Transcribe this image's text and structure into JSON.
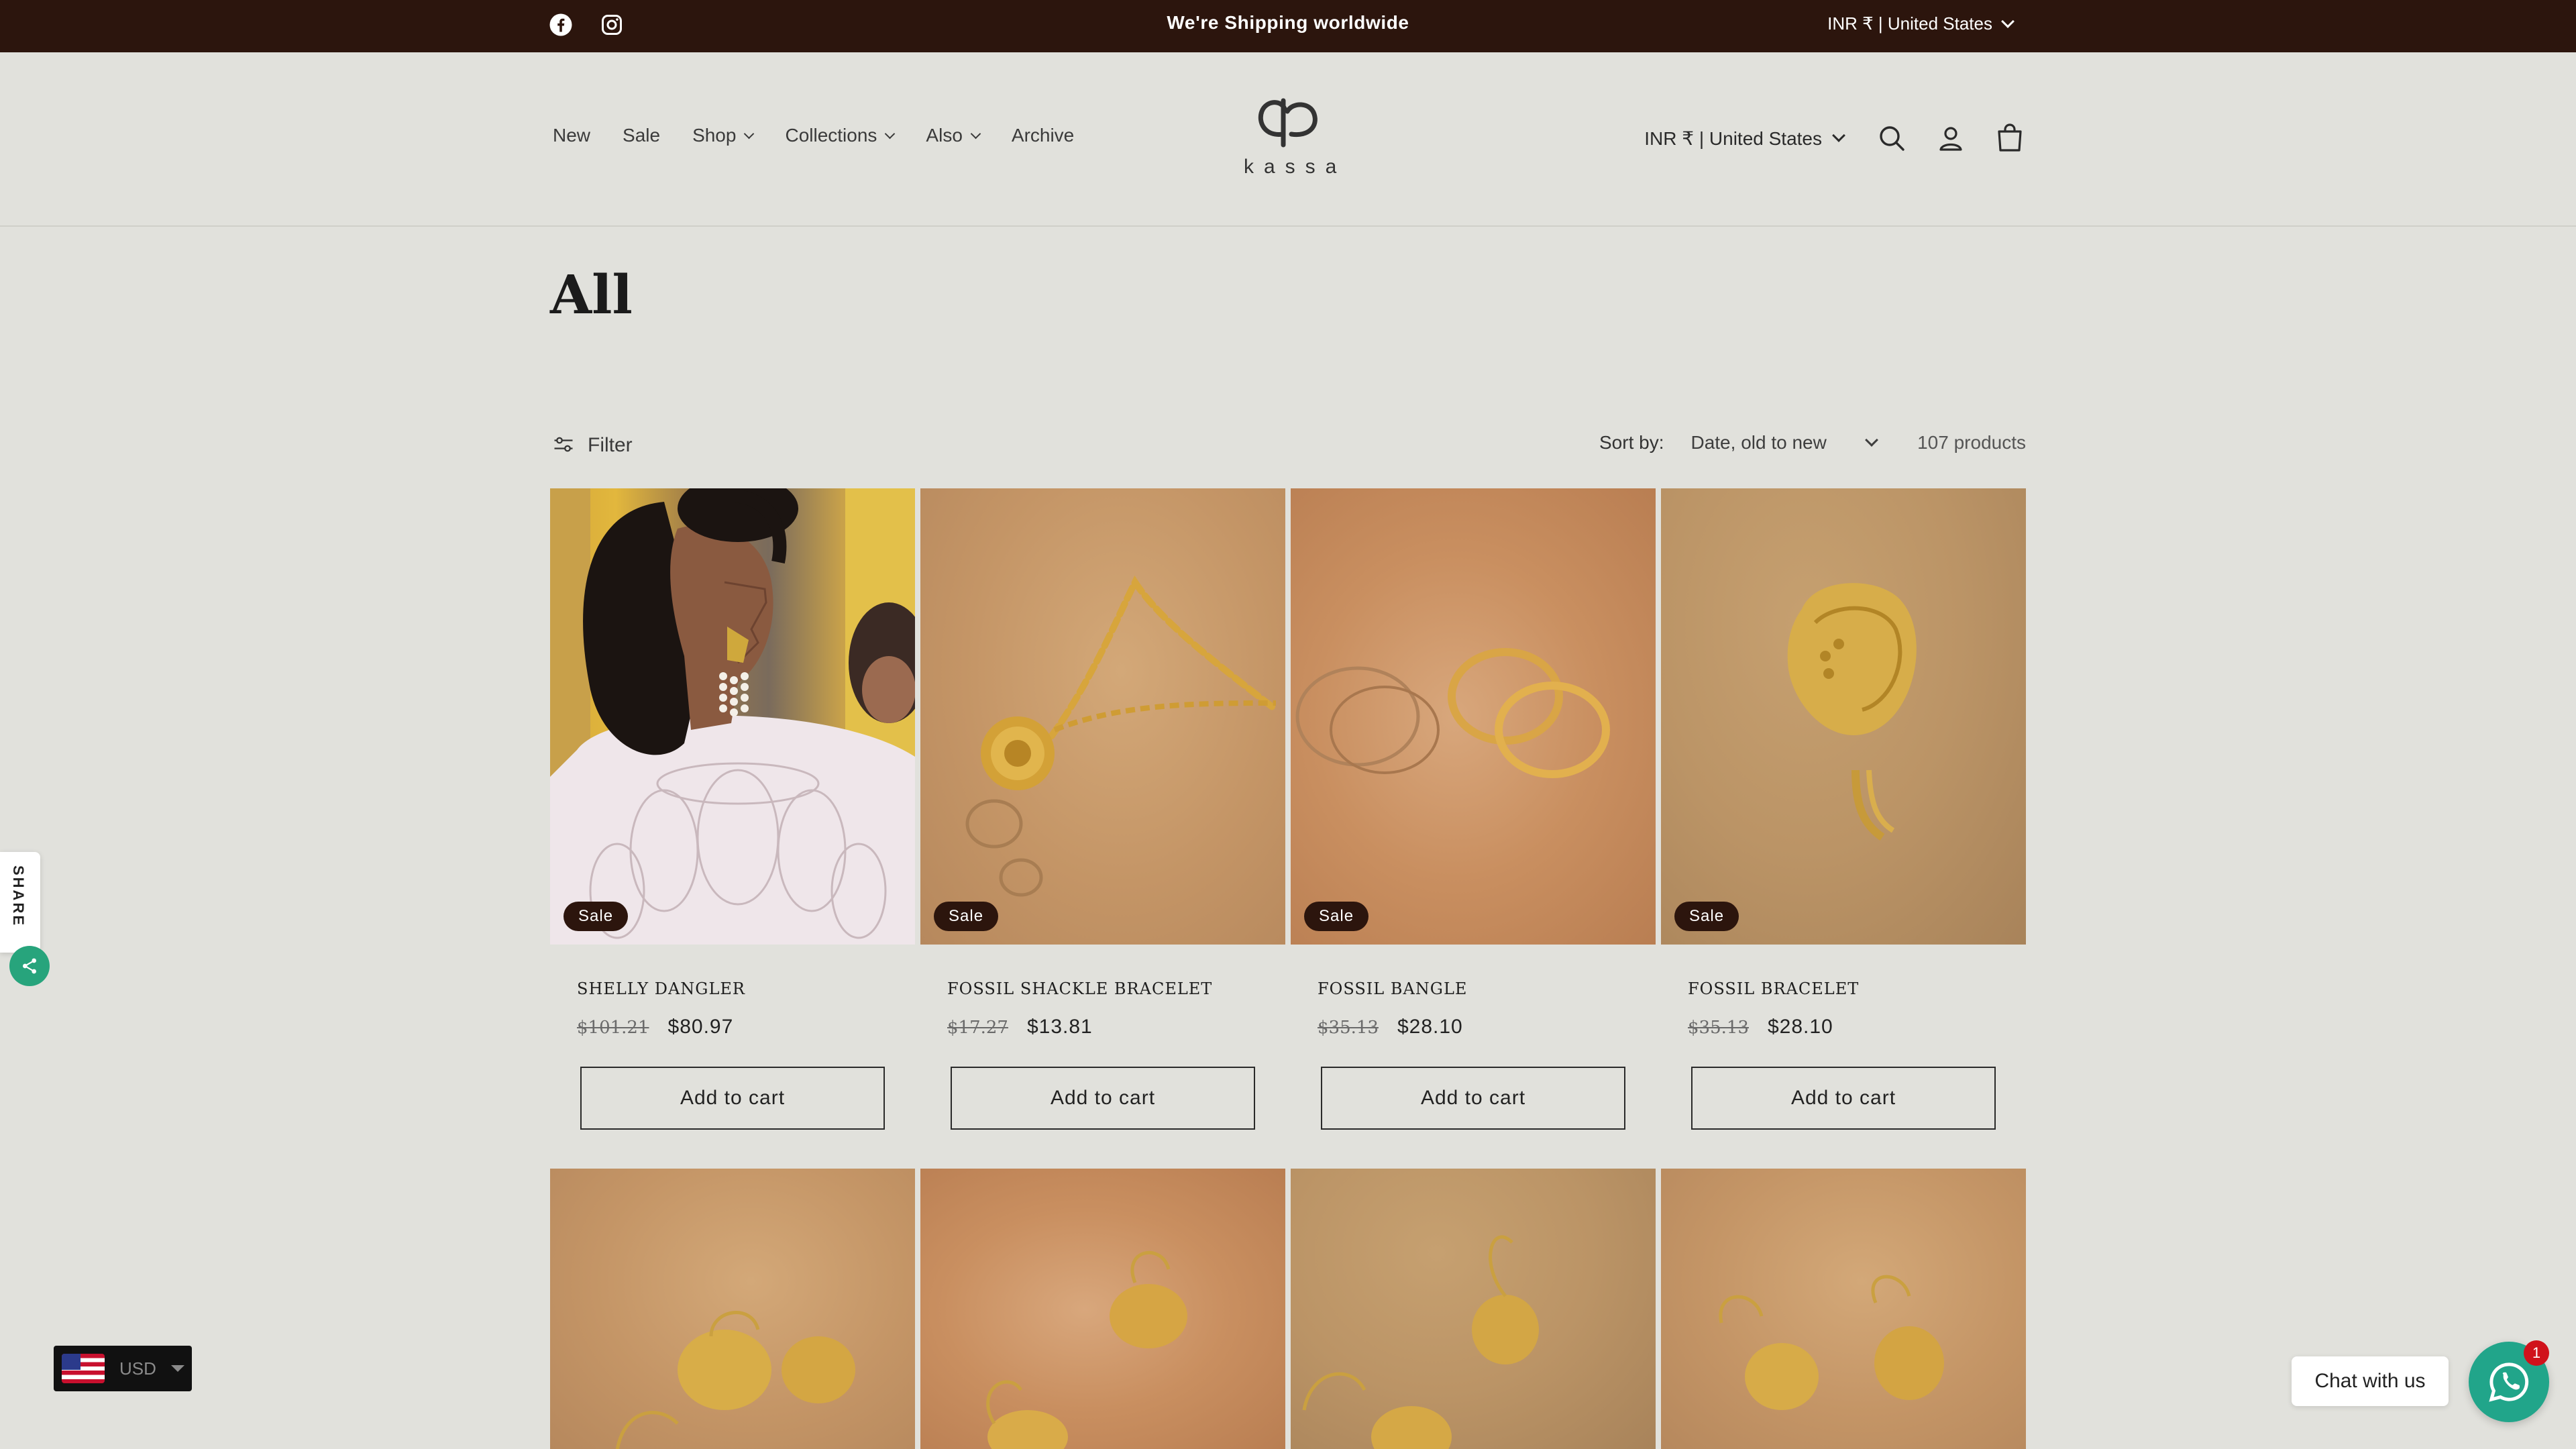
{
  "announcement": {
    "text": "We're Shipping worldwide",
    "currency_selector": "INR ₹ | United States",
    "social": [
      "facebook-icon",
      "instagram-icon"
    ]
  },
  "header": {
    "logo_text": "kassa",
    "nav": [
      {
        "label": "New",
        "has_dropdown": false
      },
      {
        "label": "Sale",
        "has_dropdown": false
      },
      {
        "label": "Shop",
        "has_dropdown": true
      },
      {
        "label": "Collections",
        "has_dropdown": true
      },
      {
        "label": "Also",
        "has_dropdown": true
      },
      {
        "label": "Archive",
        "has_dropdown": false
      }
    ],
    "currency_selector": "INR ₹ | United States",
    "icons": [
      "search-icon",
      "account-icon",
      "cart-icon"
    ]
  },
  "collection": {
    "title": "All",
    "filter_label": "Filter",
    "sort_label": "Sort by:",
    "sort_value": "Date, old to new",
    "product_count": "107 products"
  },
  "products": [
    {
      "name": "SHELLY DANGLER",
      "old_price": "$101.21",
      "price": "$80.97",
      "badge": "Sale",
      "button": "Add to cart"
    },
    {
      "name": "FOSSIL SHACKLE BRACELET",
      "old_price": "$17.27",
      "price": "$13.81",
      "badge": "Sale",
      "button": "Add to cart"
    },
    {
      "name": "FOSSIL BANGLE",
      "old_price": "$35.13",
      "price": "$28.10",
      "badge": "Sale",
      "button": "Add to cart"
    },
    {
      "name": "FOSSIL BRACELET",
      "old_price": "$35.13",
      "price": "$28.10",
      "badge": "Sale",
      "button": "Add to cart"
    }
  ],
  "widgets": {
    "share_label": "SHARE",
    "currency_code": "USD",
    "chat_label": "Chat with us",
    "chat_badge": "1"
  },
  "colors": {
    "background": "#e1e1dc",
    "announcement_bar": "#2c150d",
    "badge": "#2c150d",
    "whatsapp": "#21a58a"
  }
}
